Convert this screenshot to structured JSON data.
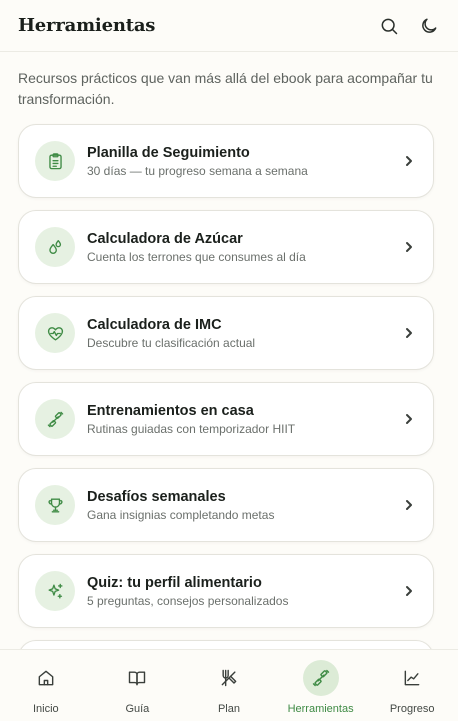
{
  "header": {
    "title": "Herramientas",
    "search_icon": "search-icon",
    "theme_icon": "moon-icon"
  },
  "intro": "Recursos prácticos que van más allá del ebook para acompañar tu transformación.",
  "tools": [
    {
      "title": "Planilla de Seguimiento",
      "subtitle": "30 días — tu progreso semana a semana",
      "icon": "clipboard-icon"
    },
    {
      "title": "Calculadora de Azúcar",
      "subtitle": "Cuenta los terrones que consumes al día",
      "icon": "droplets-icon"
    },
    {
      "title": "Calculadora de IMC",
      "subtitle": "Descubre tu clasificación actual",
      "icon": "heart-pulse-icon"
    },
    {
      "title": "Entrenamientos en casa",
      "subtitle": "Rutinas guiadas con temporizador HIIT",
      "icon": "dumbbell-icon"
    },
    {
      "title": "Desafíos semanales",
      "subtitle": "Gana insignias completando metas",
      "icon": "trophy-icon"
    },
    {
      "title": "Quiz: tu perfil alimentario",
      "subtitle": "5 preguntas, consejos personalizados",
      "icon": "sparkles-icon"
    }
  ],
  "nav": [
    {
      "label": "Inicio",
      "icon": "home-icon",
      "active": false
    },
    {
      "label": "Guía",
      "icon": "book-icon",
      "active": false
    },
    {
      "label": "Plan",
      "icon": "utensils-icon",
      "active": false
    },
    {
      "label": "Herramientas",
      "icon": "dumbbell-icon",
      "active": true
    },
    {
      "label": "Progreso",
      "icon": "chart-line-icon",
      "active": false
    }
  ],
  "colors": {
    "accent": "#3f8b45",
    "accent_soft": "#e6f1e2",
    "background": "#fdfcf8"
  }
}
